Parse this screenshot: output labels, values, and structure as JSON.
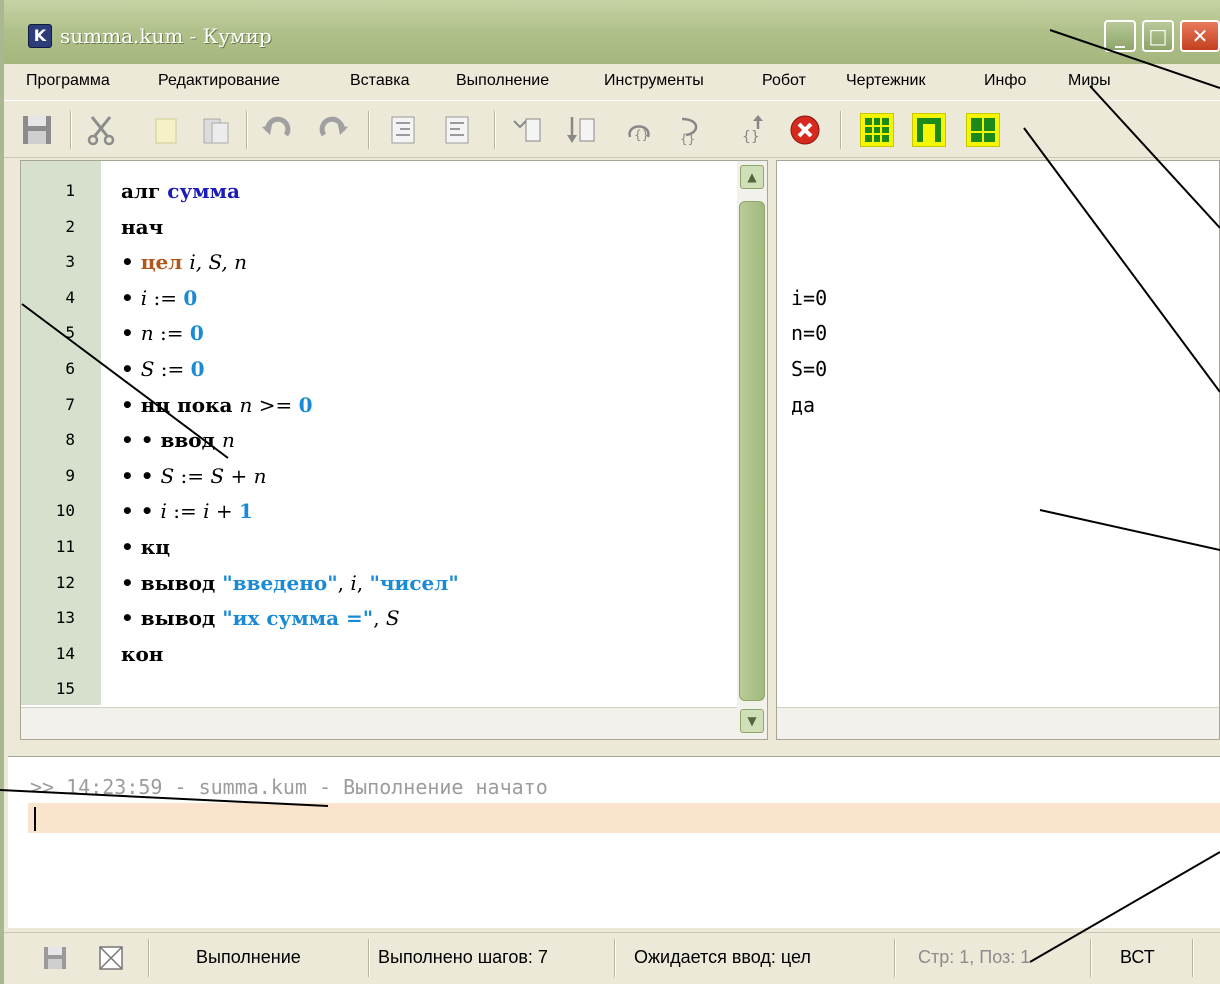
{
  "window": {
    "title": "summa.kum - Кумир",
    "app_icon": "K"
  },
  "menu": {
    "items": [
      "Программа",
      "Редактирование",
      "Вставка",
      "Выполнение",
      "Инструменты",
      "Робот",
      "Чертежник",
      "Инфо",
      "Миры"
    ]
  },
  "toolbar": {
    "icons": [
      "save-icon",
      "cut-icon",
      "copy-icon",
      "paste-icon",
      "undo-icon",
      "redo-icon",
      "indent-icon",
      "unindent-icon",
      "step-in-icon",
      "run-icon",
      "step-over-icon",
      "step-out-icon",
      "step-out-loop-icon",
      "stop-icon",
      "robot-grid-icon",
      "robot-field-icon",
      "draftsman-icon"
    ]
  },
  "editor": {
    "line_numbers": [
      "1",
      "2",
      "3",
      "4",
      "5",
      "6",
      "7",
      "8",
      "9",
      "10",
      "11",
      "12",
      "13",
      "14",
      "15"
    ],
    "lines": [
      {
        "parts": [
          {
            "t": "алг ",
            "c": "kw"
          },
          {
            "t": "сумма",
            "c": "kw-blue"
          }
        ]
      },
      {
        "parts": [
          {
            "t": "нач",
            "c": "kw"
          }
        ]
      },
      {
        "parts": [
          {
            "t": "• ",
            "c": "kw"
          },
          {
            "t": "цел ",
            "c": "kw-type"
          },
          {
            "t": "i, S, n",
            "c": "var"
          }
        ]
      },
      {
        "parts": [
          {
            "t": "• ",
            "c": "kw"
          },
          {
            "t": "i",
            "c": "var"
          },
          {
            "t": " := ",
            "c": ""
          },
          {
            "t": "0",
            "c": "num"
          }
        ]
      },
      {
        "parts": [
          {
            "t": "• ",
            "c": "kw"
          },
          {
            "t": "n",
            "c": "var"
          },
          {
            "t": " := ",
            "c": ""
          },
          {
            "t": "0",
            "c": "num"
          }
        ]
      },
      {
        "parts": [
          {
            "t": "• ",
            "c": "kw"
          },
          {
            "t": "S",
            "c": "var"
          },
          {
            "t": " := ",
            "c": ""
          },
          {
            "t": "0",
            "c": "num"
          }
        ]
      },
      {
        "parts": [
          {
            "t": "• ",
            "c": "kw"
          },
          {
            "t": "нц пока ",
            "c": "kw"
          },
          {
            "t": "n",
            "c": "var"
          },
          {
            "t": " >= ",
            "c": ""
          },
          {
            "t": "0",
            "c": "num"
          }
        ]
      },
      {
        "parts": [
          {
            "t": "• • ",
            "c": "kw"
          },
          {
            "t": "ввод ",
            "c": "kw"
          },
          {
            "t": "n",
            "c": "var"
          }
        ]
      },
      {
        "parts": [
          {
            "t": "• • ",
            "c": "kw"
          },
          {
            "t": "S",
            "c": "var"
          },
          {
            "t": " := ",
            "c": ""
          },
          {
            "t": "S",
            "c": "var"
          },
          {
            "t": " + ",
            "c": ""
          },
          {
            "t": "n",
            "c": "var"
          }
        ]
      },
      {
        "parts": [
          {
            "t": "• • ",
            "c": "kw"
          },
          {
            "t": "i",
            "c": "var"
          },
          {
            "t": " := ",
            "c": ""
          },
          {
            "t": "i",
            "c": "var"
          },
          {
            "t": " + ",
            "c": ""
          },
          {
            "t": "1",
            "c": "num"
          }
        ]
      },
      {
        "parts": [
          {
            "t": "• ",
            "c": "kw"
          },
          {
            "t": "кц",
            "c": "kw"
          }
        ]
      },
      {
        "parts": [
          {
            "t": "• ",
            "c": "kw"
          },
          {
            "t": "вывод ",
            "c": "kw"
          },
          {
            "t": "\"введено\"",
            "c": "str"
          },
          {
            "t": ", ",
            "c": ""
          },
          {
            "t": "i",
            "c": "var"
          },
          {
            "t": ", ",
            "c": ""
          },
          {
            "t": "\"чисел\"",
            "c": "str"
          }
        ]
      },
      {
        "parts": [
          {
            "t": "• ",
            "c": "kw"
          },
          {
            "t": "вывод ",
            "c": "kw"
          },
          {
            "t": "\"их сумма =\"",
            "c": "str"
          },
          {
            "t": ", ",
            "c": ""
          },
          {
            "t": "S",
            "c": "var"
          }
        ]
      },
      {
        "parts": [
          {
            "t": "кон",
            "c": "kw"
          }
        ]
      },
      {
        "parts": []
      }
    ]
  },
  "margin": {
    "values": [
      "",
      "",
      "",
      "i=0",
      "n=0",
      "S=0",
      "да",
      "",
      "",
      "",
      "",
      "",
      "",
      "",
      ""
    ]
  },
  "console": {
    "message": ">> 14:23:59 - summa.kum - Выполнение начато",
    "input_value": ""
  },
  "status": {
    "mode": "Выполнение",
    "steps": "Выполнено шагов: 7",
    "awaiting": "Ожидается ввод: цел",
    "position": "Стр: 1, Поз: 1",
    "insert_mode": "ВСТ"
  },
  "colors": {
    "titlebar": "#b0c08a",
    "gutter": "#d6e0cc",
    "keyword_blue": "#1c1cb6",
    "type_keyword": "#b3551b",
    "number": "#1a8ad4",
    "console_input_bg": "#fbe4cc",
    "robot_buttons": "#f6f600"
  }
}
